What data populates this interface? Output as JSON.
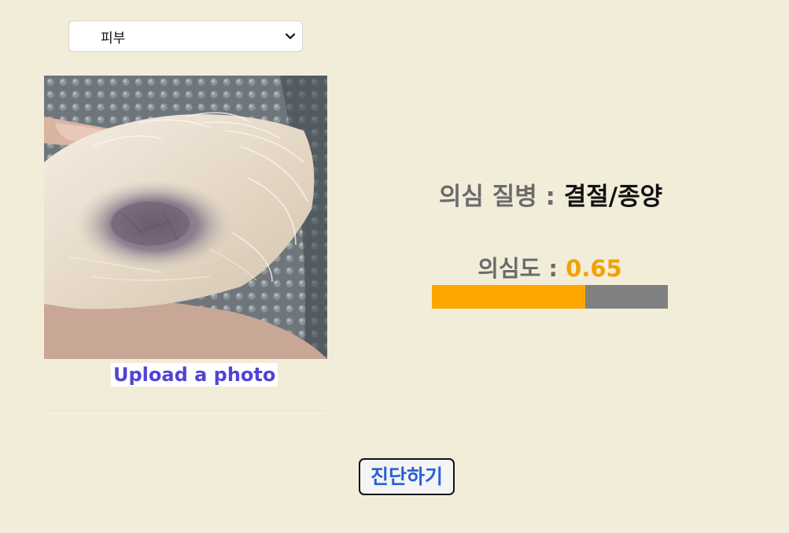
{
  "category_select": {
    "selected": "피부"
  },
  "photo": {
    "upload_label": "Upload a photo"
  },
  "result": {
    "disease_label": "의심 질병 : ",
    "disease_value": "결절/종양",
    "confidence_label": "의심도 : ",
    "confidence_value": "0.65",
    "confidence_fraction": 0.65
  },
  "actions": {
    "diagnose_label": "진단하기"
  },
  "colors": {
    "background": "#f2edd9",
    "progress_fill": "#ffa500",
    "progress_track": "#808080",
    "confidence_accent": "#f5a000",
    "upload_link": "#5144d3",
    "diagnose_text": "#2a5fd8"
  }
}
